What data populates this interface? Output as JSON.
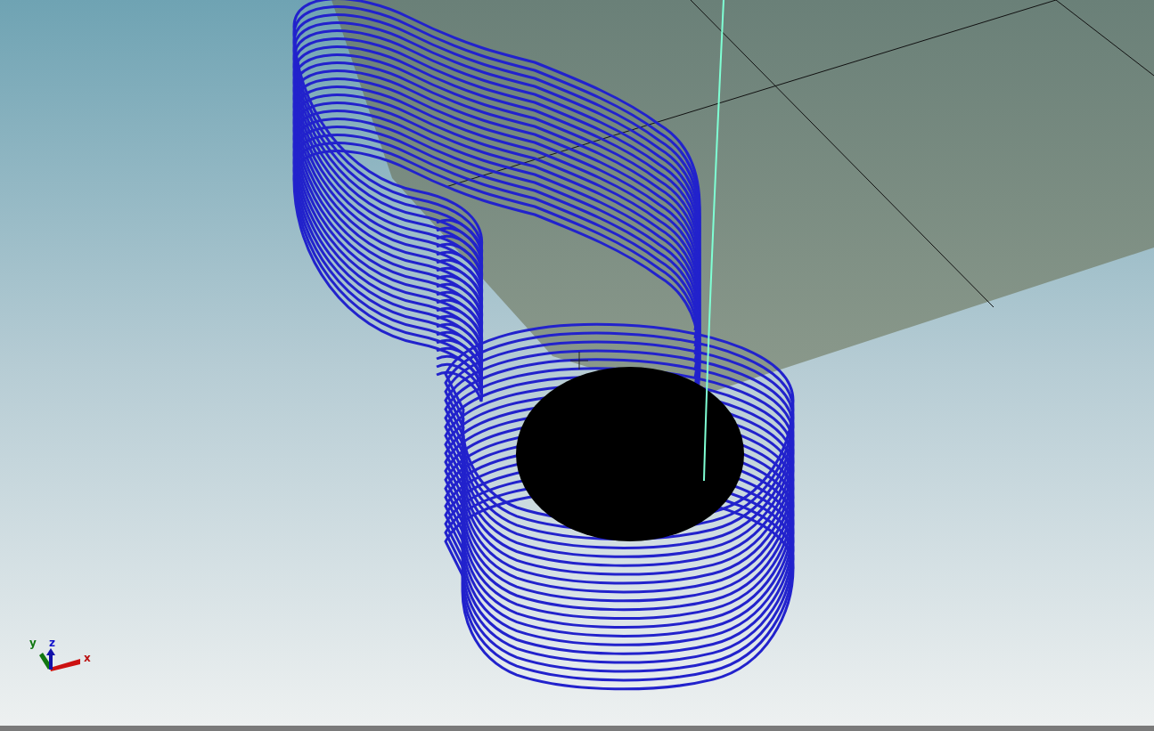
{
  "viewport": {
    "axis_triad": {
      "x_label": "x",
      "y_label": "y",
      "z_label": "z"
    }
  }
}
